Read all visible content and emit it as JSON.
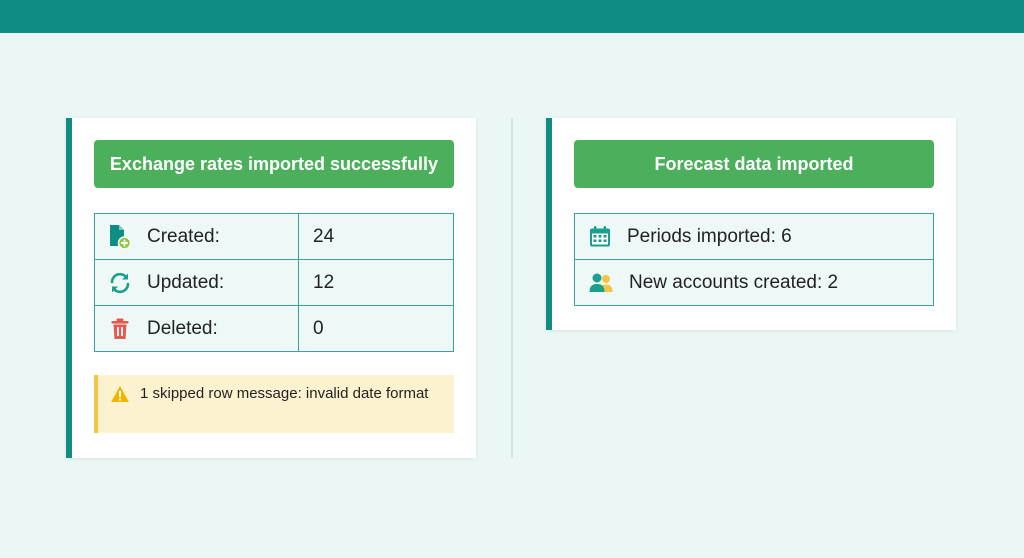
{
  "colors": {
    "header": "#0f8d84",
    "accent": "#0f8d84",
    "success_banner": "#4caf5c",
    "warning_bg": "#fdf2cf",
    "warning_border": "#f4c542",
    "delete_red": "#e05a4f"
  },
  "exchange_card": {
    "banner": "Exchange rates imported successfully",
    "rows": [
      {
        "icon": "file-add-icon",
        "label": "Created:",
        "value": "24"
      },
      {
        "icon": "refresh-icon",
        "label": "Updated:",
        "value": "12"
      },
      {
        "icon": "trash-icon",
        "label": "Deleted:",
        "value": "0"
      }
    ],
    "warning": {
      "icon": "warning-icon",
      "text": "1 skipped row message: invalid date format"
    }
  },
  "forecast_card": {
    "banner": "Forecast data imported",
    "rows": [
      {
        "icon": "calendar-icon",
        "text": "Periods imported: 6"
      },
      {
        "icon": "users-icon",
        "text": "New accounts created: 2"
      }
    ]
  }
}
